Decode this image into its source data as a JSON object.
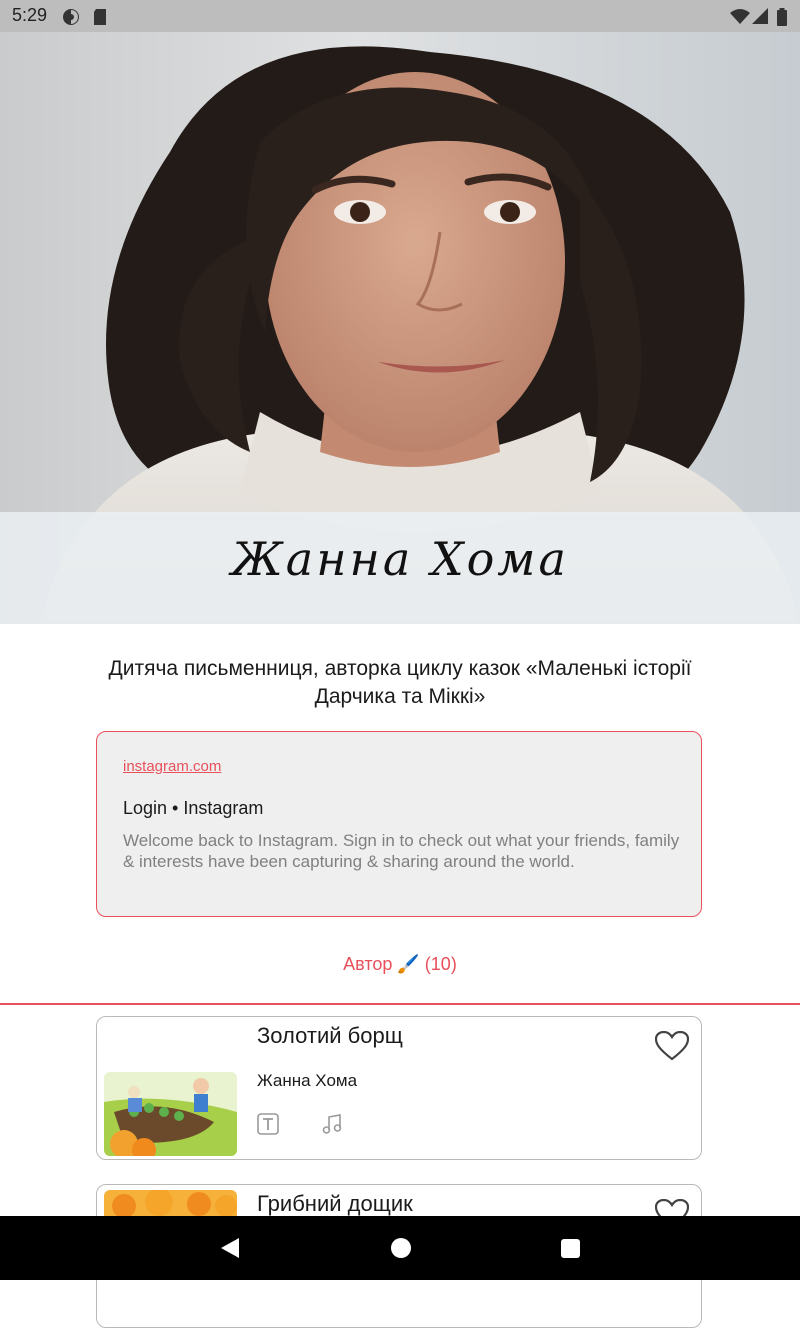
{
  "status_bar": {
    "time": "5:29"
  },
  "author": {
    "name": "Жанна Хома",
    "bio": "Дитяча письменниця, авторка циклу казок «Маленькі історії Дарчика та Міккі»"
  },
  "link_preview": {
    "url": "instagram.com",
    "title": "Login • Instagram",
    "description": "Welcome back to Instagram. Sign in to check out what your friends, family & interests have been capturing & sharing around the world."
  },
  "tab": {
    "label": "Автор 🖌️ (10)"
  },
  "books": [
    {
      "title": "Золотий борщ",
      "author": "Жанна Хома"
    },
    {
      "title": "Грибний дощик",
      "author": ""
    }
  ],
  "colors": {
    "accent": "#e8505b",
    "status_bar": "#bdbdbd",
    "nav_bar": "#000000"
  },
  "icons": [
    "circle-half-icon",
    "sd-card-icon",
    "wifi-icon",
    "signal-icon",
    "battery-icon",
    "heart-icon",
    "text-icon",
    "music-note-icon",
    "back-icon",
    "home-icon",
    "recents-icon"
  ]
}
